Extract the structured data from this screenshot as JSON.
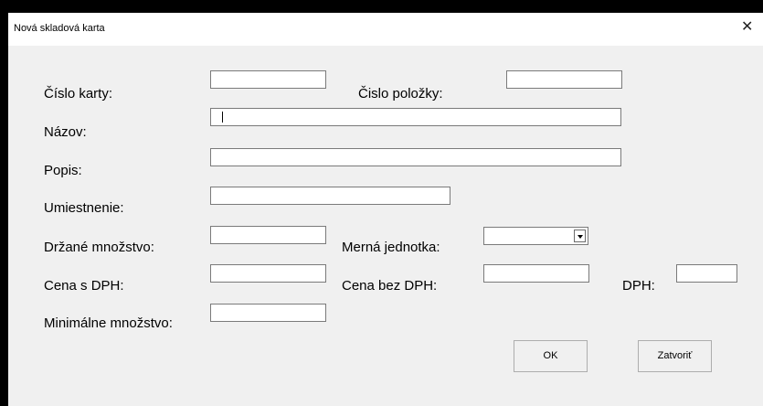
{
  "window": {
    "title": "Nová skladová karta"
  },
  "fields": {
    "cislo_karty": {
      "label": "Číslo karty:",
      "value": ""
    },
    "cislo_polozky": {
      "label": "Čislo položky:",
      "value": ""
    },
    "nazov": {
      "label": "Názov:",
      "value": ""
    },
    "popis": {
      "label": "Popis:",
      "value": ""
    },
    "umiestnenie": {
      "label": "Umiestnenie:",
      "value": ""
    },
    "drzane_mnozstvo": {
      "label": "Držané množstvo:",
      "value": ""
    },
    "merna_jednotka": {
      "label": "Merná jednotka:",
      "value": ""
    },
    "cena_s_dph": {
      "label": "Cena s DPH:",
      "value": ""
    },
    "cena_bez_dph": {
      "label": "Cena bez DPH:",
      "value": ""
    },
    "dph": {
      "label": "DPH:",
      "value": ""
    },
    "minimalne_mnozstvo": {
      "label": "Minimálne množstvo:",
      "value": ""
    }
  },
  "buttons": {
    "ok": "OK",
    "close": "Zatvoriť"
  },
  "icons": {
    "close": "close-icon",
    "dropdown": "chevron-down-icon"
  }
}
